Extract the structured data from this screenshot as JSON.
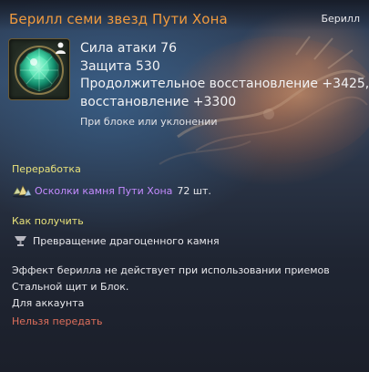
{
  "item": {
    "title": "Берилл семи звезд Пути Хона",
    "category": "Берилл",
    "icon": "green-beryl-gem-icon",
    "account_badge_icon": "person-icon"
  },
  "stats": {
    "attack": "Сила атаки 76",
    "defense": "Защита 530",
    "regen_line1": "Продолжительное восстановление +3425,",
    "regen_line2": "восстановление +3300",
    "condition": "При блоке или уклонении"
  },
  "rework": {
    "title": "Переработка",
    "material_name": "Осколки камня Пути Хона",
    "material_count": "72 шт.",
    "material_icon": "stone-shards-icon"
  },
  "obtain": {
    "title": "Как получить",
    "source": "Превращение драгоценного камня",
    "source_icon": "transform-goblet-icon"
  },
  "notes": {
    "effect": "Эффект берилла не действует при использовании приемов Стальной щит и Блок.",
    "account": "Для аккаунта",
    "no_trade": "Нельзя передать"
  },
  "colors": {
    "title": "#f09a3e",
    "section": "#e9e27a",
    "material": "#c58bff",
    "no_trade": "#e0705c"
  }
}
